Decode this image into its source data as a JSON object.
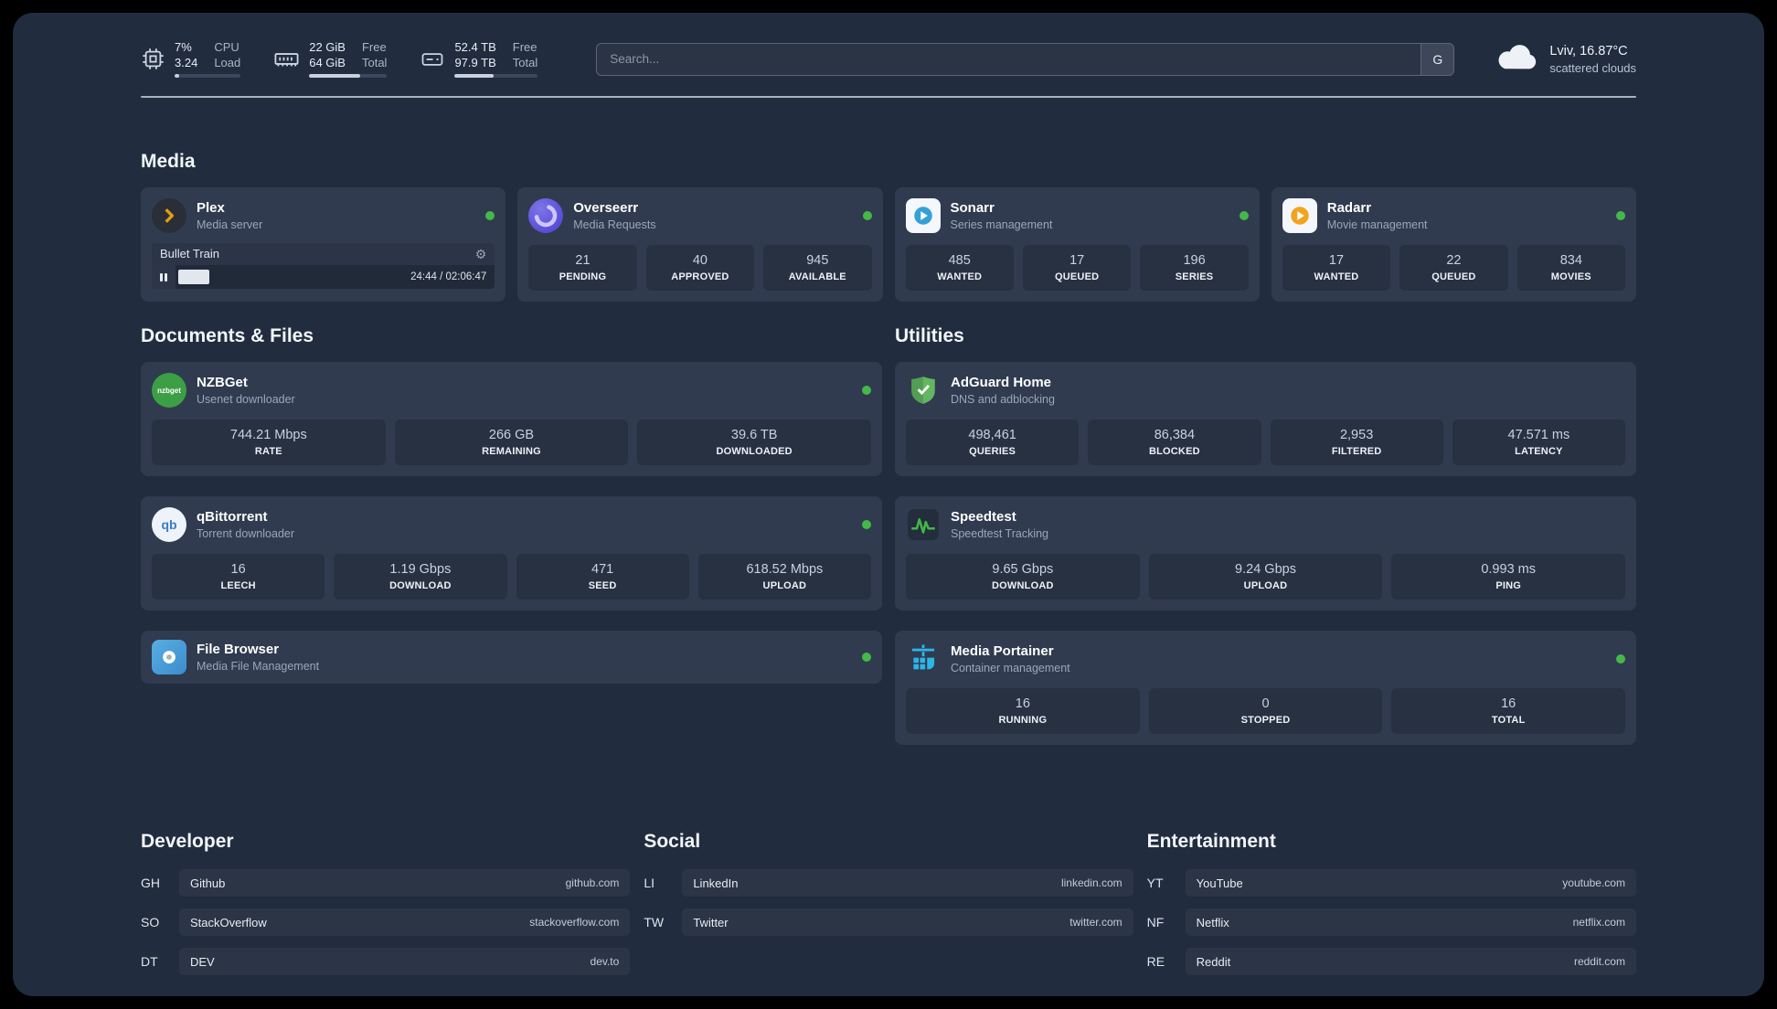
{
  "icons": {
    "gear": "⚙"
  },
  "topbar": {
    "cpu": {
      "value1": "7%",
      "label1": "CPU",
      "value2": "3.24",
      "label2": "Load"
    },
    "ram": {
      "value1": "22 GiB",
      "label1": "Free",
      "value2": "64 GiB",
      "label2": "Total"
    },
    "disk": {
      "value1": "52.4 TB",
      "label1": "Free",
      "value2": "97.9 TB",
      "label2": "Total"
    },
    "search": {
      "placeholder": "Search...",
      "button": "G"
    },
    "weather": {
      "location": "Lviv, 16.87°C",
      "condition": "scattered clouds"
    }
  },
  "media": {
    "title": "Media",
    "plex": {
      "name": "Plex",
      "subtitle": "Media server",
      "now_playing": "Bullet Train",
      "time": "24:44 / 02:06:47"
    },
    "overseerr": {
      "name": "Overseerr",
      "subtitle": "Media Requests",
      "stats": [
        {
          "value": "21",
          "label": "PENDING"
        },
        {
          "value": "40",
          "label": "APPROVED"
        },
        {
          "value": "945",
          "label": "AVAILABLE"
        }
      ]
    },
    "sonarr": {
      "name": "Sonarr",
      "subtitle": "Series management",
      "stats": [
        {
          "value": "485",
          "label": "WANTED"
        },
        {
          "value": "17",
          "label": "QUEUED"
        },
        {
          "value": "196",
          "label": "SERIES"
        }
      ]
    },
    "radarr": {
      "name": "Radarr",
      "subtitle": "Movie management",
      "stats": [
        {
          "value": "17",
          "label": "WANTED"
        },
        {
          "value": "22",
          "label": "QUEUED"
        },
        {
          "value": "834",
          "label": "MOVIES"
        }
      ]
    }
  },
  "documents": {
    "title": "Documents & Files",
    "nzbget": {
      "name": "NZBGet",
      "subtitle": "Usenet downloader",
      "icon_text": "nzbget",
      "stats": [
        {
          "value": "744.21 Mbps",
          "label": "RATE"
        },
        {
          "value": "266 GB",
          "label": "REMAINING"
        },
        {
          "value": "39.6 TB",
          "label": "DOWNLOADED"
        }
      ]
    },
    "qbittorrent": {
      "name": "qBittorrent",
      "subtitle": "Torrent downloader",
      "icon_text": "qb",
      "stats": [
        {
          "value": "16",
          "label": "LEECH"
        },
        {
          "value": "1.19 Gbps",
          "label": "DOWNLOAD"
        },
        {
          "value": "471",
          "label": "SEED"
        },
        {
          "value": "618.52 Mbps",
          "label": "UPLOAD"
        }
      ]
    },
    "filebrowser": {
      "name": "File Browser",
      "subtitle": "Media File Management"
    }
  },
  "utilities": {
    "title": "Utilities",
    "adguard": {
      "name": "AdGuard Home",
      "subtitle": "DNS and adblocking",
      "stats": [
        {
          "value": "498,461",
          "label": "QUERIES"
        },
        {
          "value": "86,384",
          "label": "BLOCKED"
        },
        {
          "value": "2,953",
          "label": "FILTERED"
        },
        {
          "value": "47.571 ms",
          "label": "LATENCY"
        }
      ]
    },
    "speedtest": {
      "name": "Speedtest",
      "subtitle": "Speedtest Tracking",
      "stats": [
        {
          "value": "9.65 Gbps",
          "label": "DOWNLOAD"
        },
        {
          "value": "9.24 Gbps",
          "label": "UPLOAD"
        },
        {
          "value": "0.993 ms",
          "label": "PING"
        }
      ]
    },
    "portainer": {
      "name": "Media Portainer",
      "subtitle": "Container management",
      "stats": [
        {
          "value": "16",
          "label": "RUNNING"
        },
        {
          "value": "0",
          "label": "STOPPED"
        },
        {
          "value": "16",
          "label": "TOTAL"
        }
      ]
    }
  },
  "bookmarks": {
    "developer": {
      "title": "Developer",
      "items": [
        {
          "abbr": "GH",
          "name": "Github",
          "url": "github.com"
        },
        {
          "abbr": "SO",
          "name": "StackOverflow",
          "url": "stackoverflow.com"
        },
        {
          "abbr": "DT",
          "name": "DEV",
          "url": "dev.to"
        }
      ]
    },
    "social": {
      "title": "Social",
      "items": [
        {
          "abbr": "LI",
          "name": "LinkedIn",
          "url": "linkedin.com"
        },
        {
          "abbr": "TW",
          "name": "Twitter",
          "url": "twitter.com"
        }
      ]
    },
    "entertainment": {
      "title": "Entertainment",
      "items": [
        {
          "abbr": "YT",
          "name": "YouTube",
          "url": "youtube.com"
        },
        {
          "abbr": "NF",
          "name": "Netflix",
          "url": "netflix.com"
        },
        {
          "abbr": "RE",
          "name": "Reddit",
          "url": "reddit.com"
        }
      ]
    }
  }
}
